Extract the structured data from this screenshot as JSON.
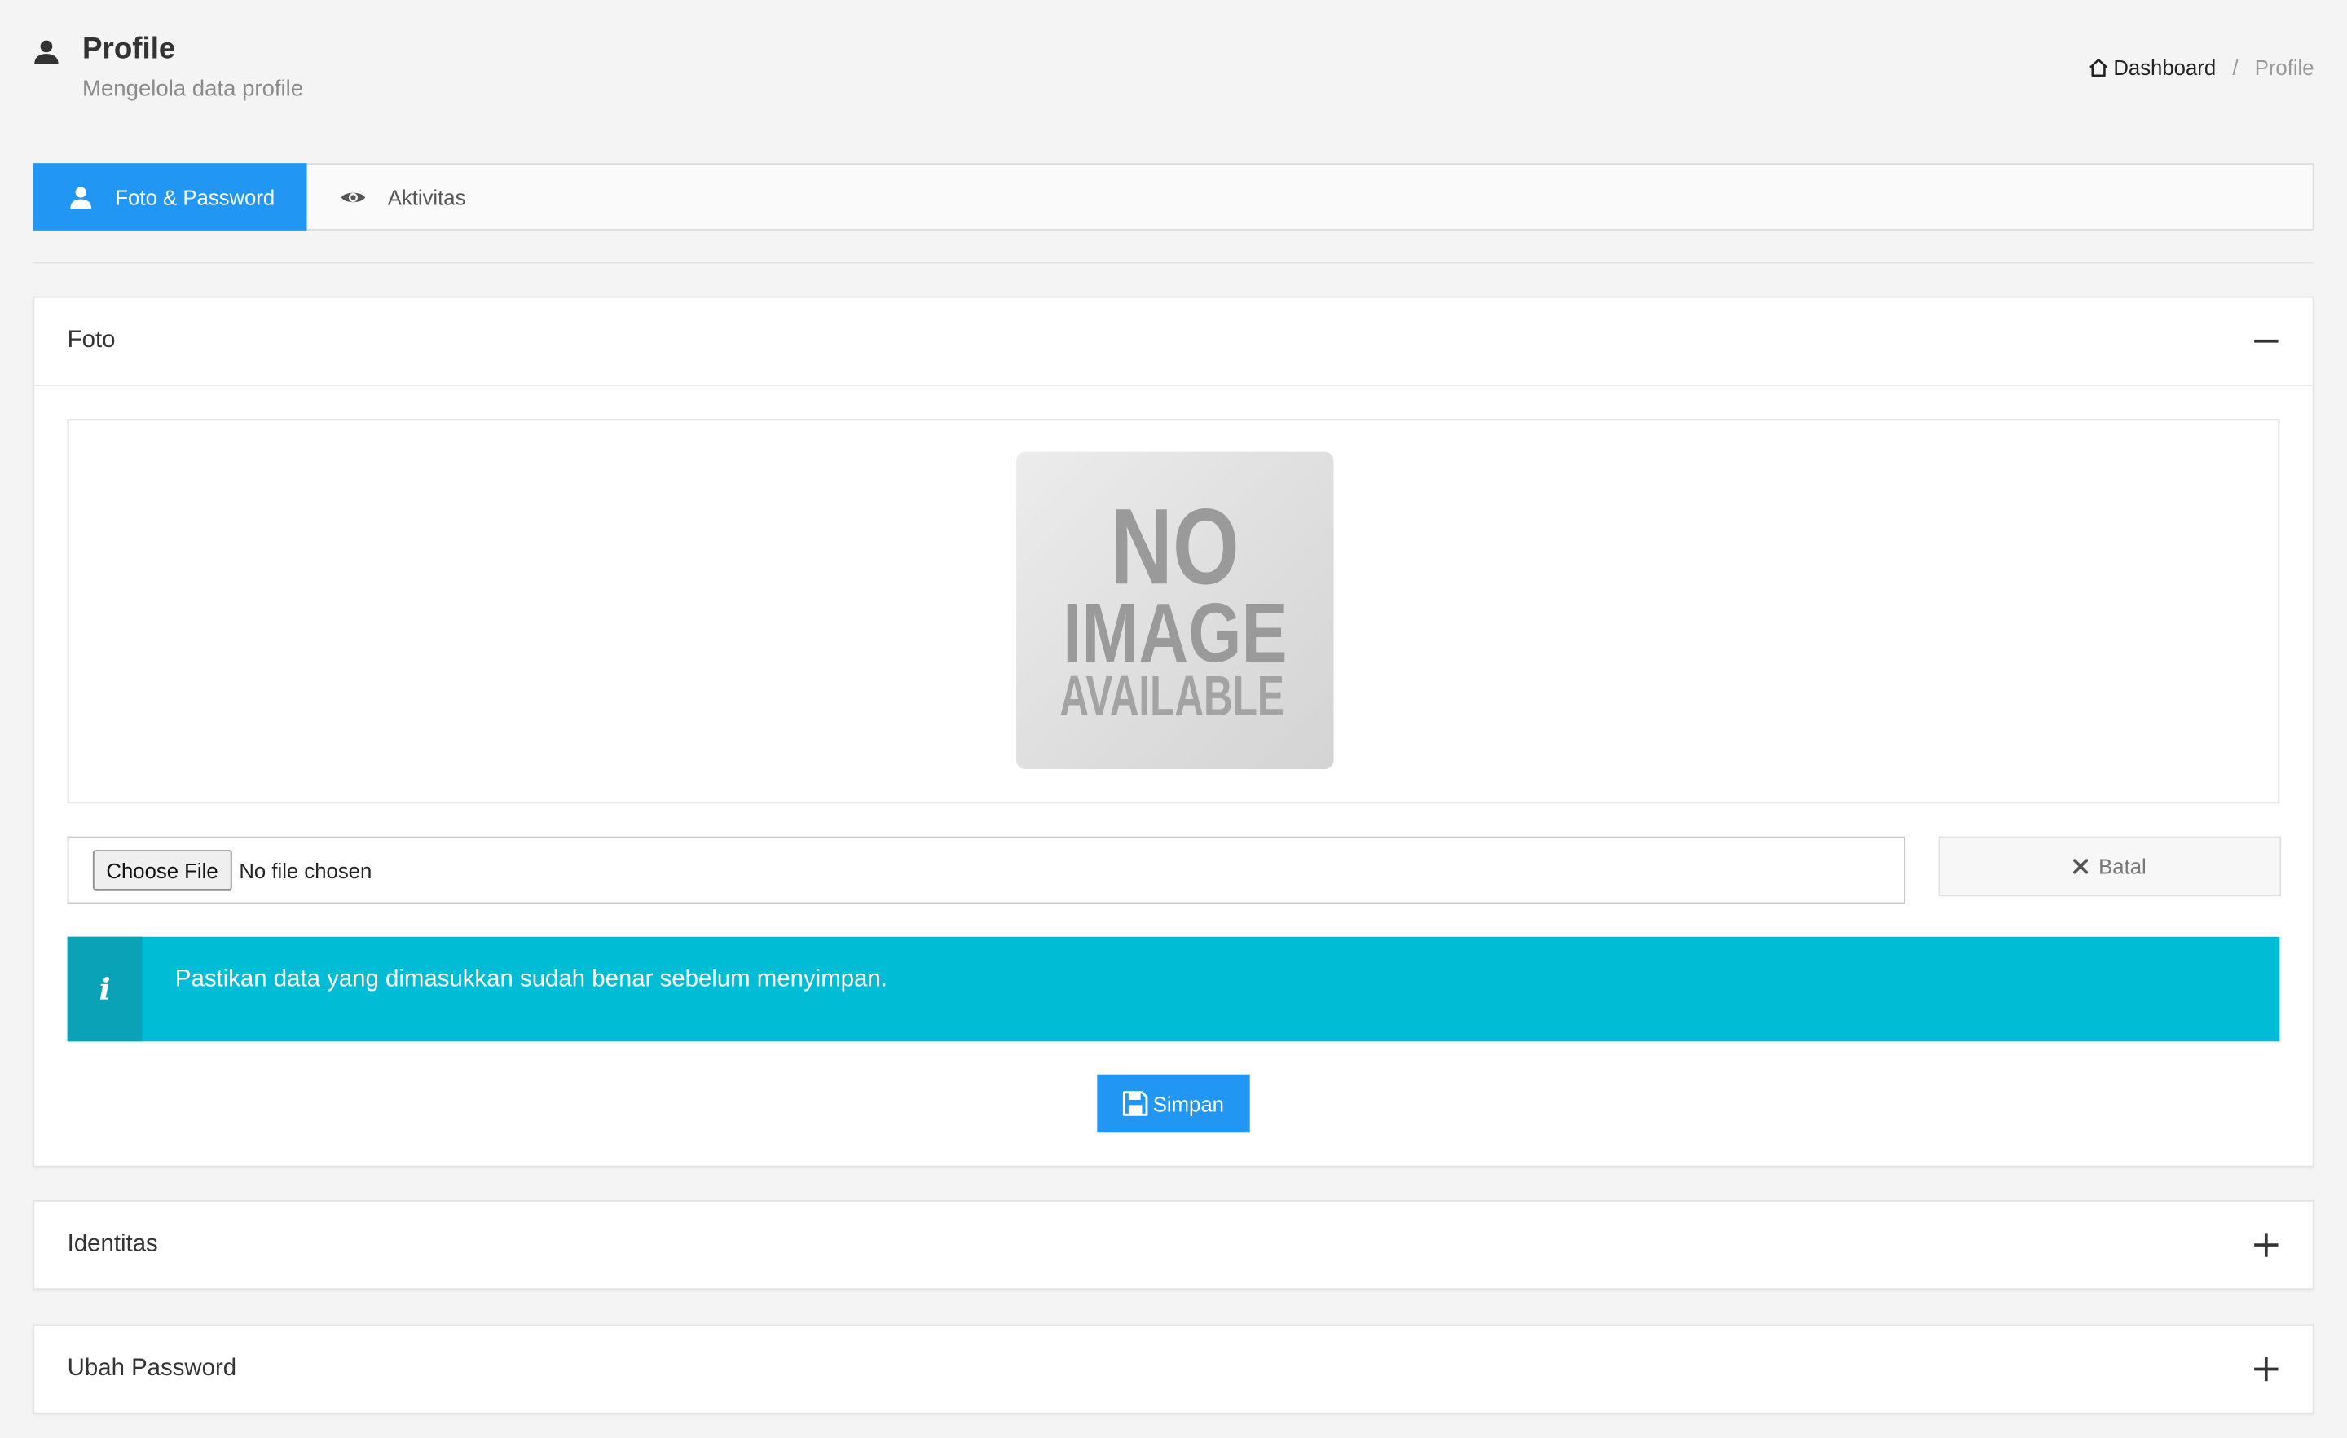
{
  "header": {
    "title": "Profile",
    "subtitle": "Mengelola data profile",
    "icon": "user-icon"
  },
  "breadcrumb": {
    "home_label": "Dashboard",
    "separator": "/",
    "current": "Profile"
  },
  "tabs": [
    {
      "label": "Foto & Password",
      "icon": "user-icon",
      "active": true
    },
    {
      "label": "Aktivitas",
      "icon": "eye-icon",
      "active": false
    }
  ],
  "panels": {
    "foto": {
      "title": "Foto",
      "toggle": "minus-icon",
      "expanded": true,
      "placeholder_image": {
        "line1": "NO",
        "line2": "IMAGE",
        "line3": "AVAILABLE"
      },
      "file_input": {
        "button_label": "Choose File",
        "status": "No file chosen"
      },
      "cancel_label": "Batal",
      "alert": {
        "icon": "i",
        "message": "Pastikan data yang dimasukkan sudah benar sebelum menyimpan."
      },
      "save_label": "Simpan"
    },
    "identitas": {
      "title": "Identitas",
      "toggle": "plus-icon",
      "expanded": false
    },
    "password": {
      "title": "Ubah Password",
      "toggle": "plus-icon",
      "expanded": false
    }
  },
  "colors": {
    "primary": "#2196f3",
    "info": "#00bcd4",
    "info_dark": "#0aa2b6",
    "background": "#f4f4f4"
  }
}
